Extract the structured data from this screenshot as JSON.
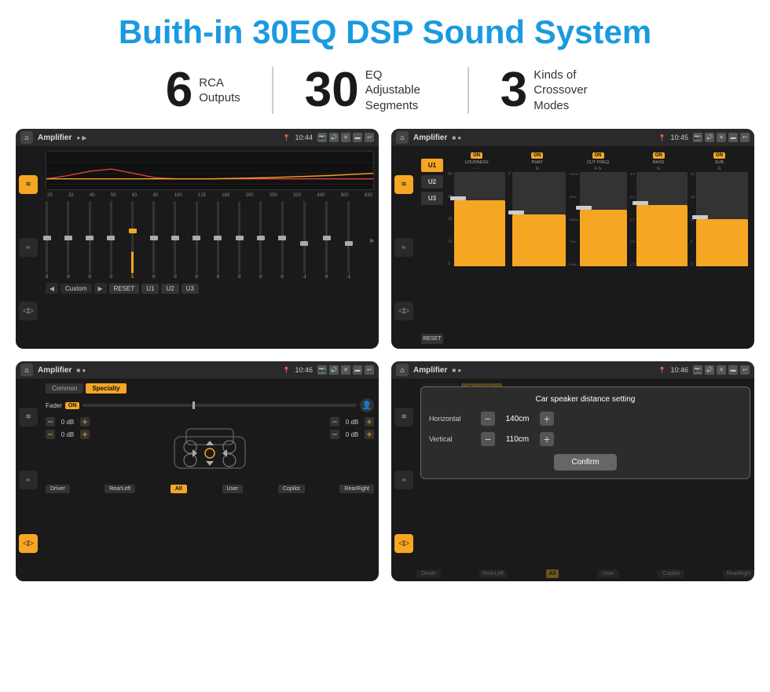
{
  "title": "Buith-in 30EQ DSP Sound System",
  "stats": [
    {
      "number": "6",
      "label": "RCA\nOutputs"
    },
    {
      "number": "30",
      "label": "EQ Adjustable\nSegments"
    },
    {
      "number": "3",
      "label": "Kinds of\nCrossover Modes"
    }
  ],
  "screens": [
    {
      "id": "eq",
      "topbar": {
        "title": "Amplifier",
        "time": "10:44"
      },
      "freqLabels": [
        "25",
        "32",
        "40",
        "50",
        "63",
        "80",
        "100",
        "125",
        "160",
        "200",
        "250",
        "320",
        "400",
        "500",
        "630"
      ],
      "sliderValues": [
        "0",
        "0",
        "0",
        "0",
        "5",
        "0",
        "0",
        "0",
        "0",
        "0",
        "0",
        "0",
        "-1",
        "0",
        "-1"
      ],
      "presets": [
        "Custom",
        "RESET",
        "U1",
        "U2",
        "U3"
      ]
    },
    {
      "id": "mixer",
      "topbar": {
        "title": "Amplifier",
        "time": "10:45"
      },
      "presets": [
        "U1",
        "U2",
        "U3"
      ],
      "channels": [
        {
          "name": "LOUDNESS",
          "on": true,
          "fillPct": 70
        },
        {
          "name": "PHAT",
          "on": true,
          "fillPct": 55
        },
        {
          "name": "CUT FREQ",
          "on": true,
          "fillPct": 60
        },
        {
          "name": "BASS",
          "on": true,
          "fillPct": 65
        },
        {
          "name": "SUB",
          "on": true,
          "fillPct": 50
        }
      ],
      "resetLabel": "RESET"
    },
    {
      "id": "fader",
      "topbar": {
        "title": "Amplifier",
        "time": "10:46"
      },
      "tabs": [
        "Common",
        "Specialty"
      ],
      "activeTab": "Specialty",
      "faderLabel": "Fader",
      "faderOn": "ON",
      "volumeControls": [
        {
          "value": "0 dB"
        },
        {
          "value": "0 dB"
        },
        {
          "value": "0 dB"
        },
        {
          "value": "0 dB"
        }
      ],
      "bottomBtns": [
        "Driver",
        "RearLeft",
        "All",
        "User",
        "Copilot",
        "RearRight"
      ]
    },
    {
      "id": "distance",
      "topbar": {
        "title": "Amplifier",
        "time": "10:46"
      },
      "tabs": [
        "Common",
        "Specialty"
      ],
      "dialog": {
        "title": "Car speaker distance setting",
        "horizontal": {
          "label": "Horizontal",
          "value": "140cm"
        },
        "vertical": {
          "label": "Vertical",
          "value": "110cm"
        },
        "confirmLabel": "Confirm"
      },
      "bottomBtns": [
        "Driver",
        "RearLeft",
        "All",
        "User",
        "Copilot",
        "RearRight"
      ]
    }
  ]
}
